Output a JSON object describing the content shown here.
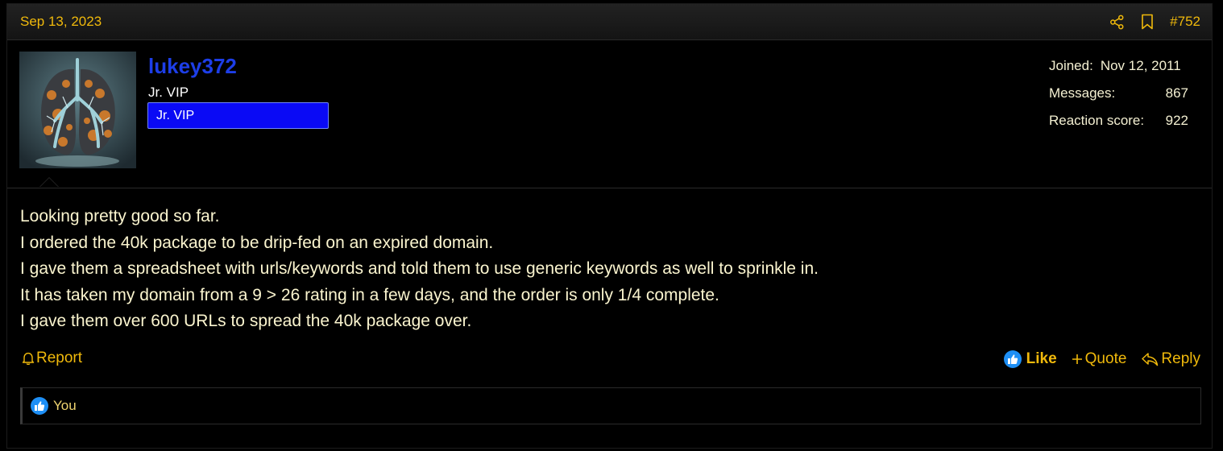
{
  "post": {
    "date": "Sep 13, 2023",
    "number": "#752",
    "icons": [
      "share-icon",
      "bookmark-icon"
    ]
  },
  "user": {
    "name": "lukey372",
    "title": "Jr. VIP",
    "banner": "Jr. VIP",
    "stats": {
      "joined_label": "Joined:",
      "joined_value": "Nov 12, 2011",
      "messages_label": "Messages:",
      "messages_value": "867",
      "reaction_label": "Reaction score:",
      "reaction_value": "922"
    }
  },
  "message": {
    "lines": [
      "Looking pretty good so far.",
      "I ordered the 40k package to be drip-fed on an expired domain.",
      "I gave them a spreadsheet with urls/keywords and told them to use generic keywords as well to sprinkle in.",
      "It has taken my domain from a 9 > 26 rating in a few days, and the order is only 1/4 complete.",
      "I gave them over 600 URLs to spread the 40k package over."
    ]
  },
  "actions": {
    "report": "Report",
    "like": "Like",
    "quote": "Quote",
    "reply": "Reply"
  },
  "reactions": {
    "text": "You"
  },
  "colors": {
    "accent": "#f0b90b",
    "username": "#1d3ee8",
    "banner": "#0a0af5",
    "like_badge": "#1e8ff5"
  }
}
